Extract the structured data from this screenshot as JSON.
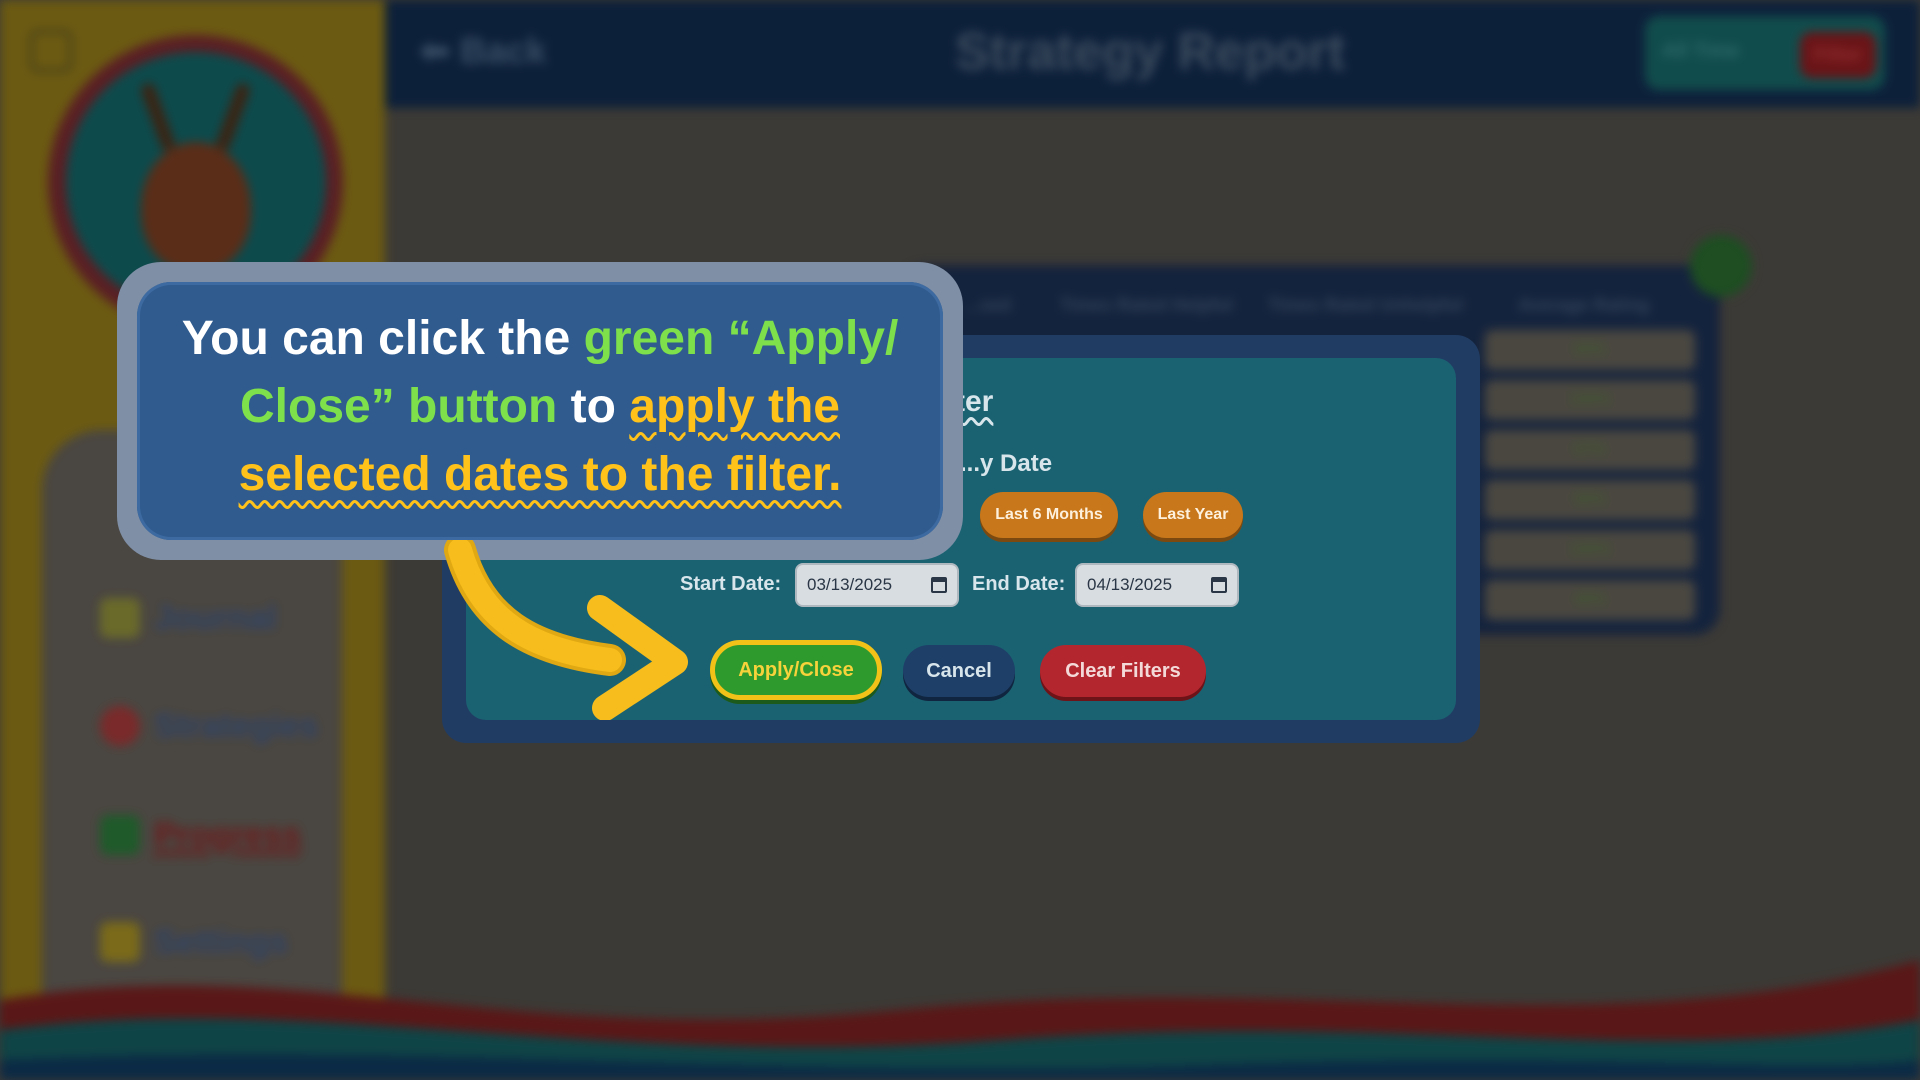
{
  "app": {
    "title": "Strategy Report",
    "back_label": "Back",
    "filter_segment": {
      "all_time": "All Time",
      "filter": "Filter"
    }
  },
  "sidebar": {
    "items": [
      {
        "label": "Journal",
        "icon": "pencil-icon",
        "color": "#6a6a2a"
      },
      {
        "label": "Strategies",
        "icon": "lightbulb-icon",
        "color": "#7a2a2a"
      },
      {
        "label": "Progress",
        "icon": "bar-chart-icon",
        "color": "#1f5a2a",
        "active": true
      },
      {
        "label": "Settings",
        "icon": "gear-icon",
        "color": "#7a6a1a"
      }
    ]
  },
  "report": {
    "columns": [
      "...sed",
      "Times Rated Helpful",
      "Times Rated Unhelpful",
      "Average Rating"
    ],
    "ratings": [
      "83%",
      "100%",
      "67%",
      "50%",
      "100%",
      "40%"
    ]
  },
  "modal": {
    "title_fragment": "...ter",
    "section_label": "...y Date",
    "presets": [
      "Last 6 Months",
      "Last Year"
    ],
    "start_label": "Start Date:",
    "start_value": "03/13/2025",
    "end_label": "End Date:",
    "end_value": "04/13/2025",
    "apply_label": "Apply/Close",
    "cancel_label": "Cancel",
    "clear_label": "Clear Filters"
  },
  "tooltip": {
    "part1": "You can click the ",
    "part2": "green “Apply/ Close” button",
    "part3": " to ",
    "part4": "apply the selected dates to the filter."
  },
  "colors": {
    "accent_green": "#7ee04a",
    "accent_yellow": "#ffc21a",
    "modal_bg": "#1a6272",
    "apply_bg": "#2e9a2e",
    "clear_bg": "#b3262e"
  }
}
